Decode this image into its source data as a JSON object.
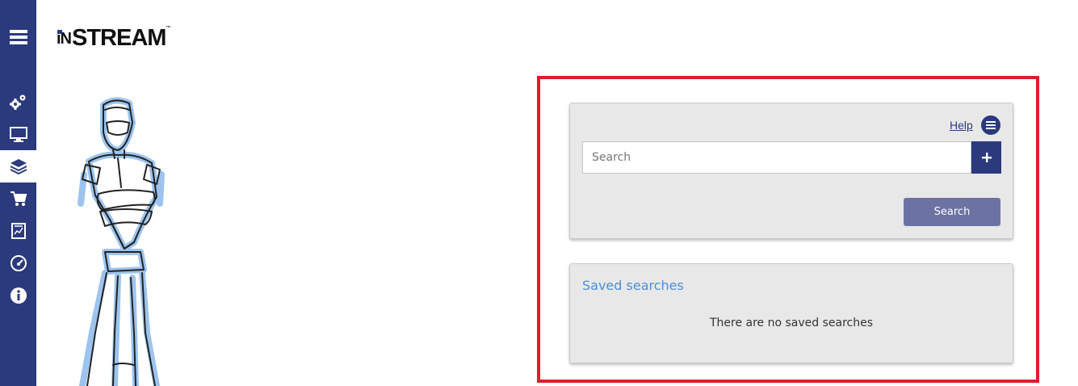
{
  "brand": {
    "prefix": "iN",
    "name": "STREAM",
    "tm": "™"
  },
  "sidebar": {
    "items": [
      {
        "icon": "hamburger-menu-icon"
      },
      {
        "icon": "gears-icon"
      },
      {
        "icon": "monitor-icon"
      },
      {
        "icon": "layers-icon",
        "active": true
      },
      {
        "icon": "shopping-cart-icon"
      },
      {
        "icon": "report-chart-icon"
      },
      {
        "icon": "speedometer-icon"
      },
      {
        "icon": "info-icon"
      }
    ],
    "color": "#2b3a7c"
  },
  "search_panel": {
    "help_label": "Help",
    "input_placeholder": "Search",
    "input_value": "",
    "search_button_label": "Search"
  },
  "saved_panel": {
    "title": "Saved searches",
    "empty_message": "There are no saved searches"
  },
  "colors": {
    "accent": "#2b3a7c",
    "highlight_frame": "#e21b2b",
    "link_blue": "#4a90d9",
    "button": "#6c73a3"
  }
}
